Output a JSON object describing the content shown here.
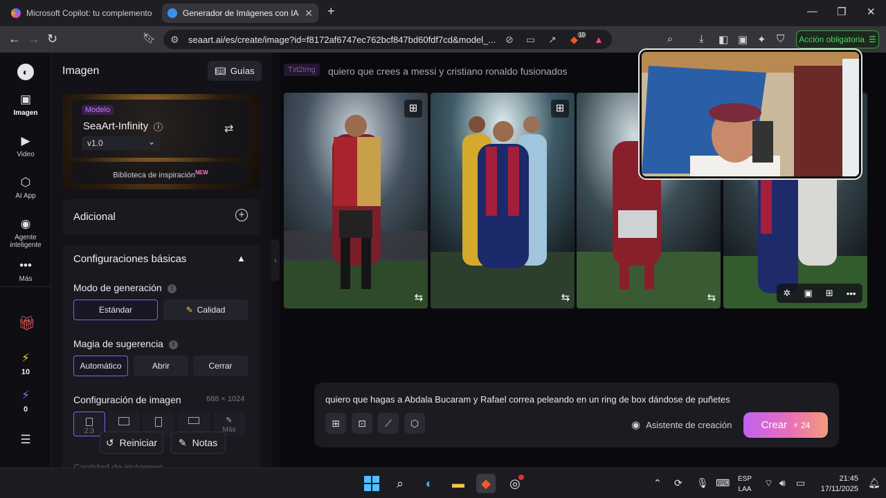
{
  "browser": {
    "tabs": [
      {
        "label": "Microsoft Copilot: tu complemento de",
        "active": false
      },
      {
        "label": "Generador de Imágenes con IA -",
        "active": true
      }
    ],
    "url": "seaart.ai/es/create/image?id=f8172af6747ec762bcf847bd60fdf7cd&model_...",
    "brave_badge": "10",
    "action_button": "Acción obligatoria"
  },
  "rail": {
    "items": [
      {
        "label": "",
        "icon": "logo-icon"
      },
      {
        "label": "Imagen",
        "icon": "image-icon"
      },
      {
        "label": "Video",
        "icon": "video-icon"
      },
      {
        "label": "AI App",
        "icon": "ai-app-icon"
      },
      {
        "label": "Agente inteligente",
        "icon": "agent-icon"
      },
      {
        "label": "Más",
        "icon": "more-icon"
      }
    ],
    "gift_icon": "gift-icon",
    "energy_count": "10",
    "stamina_count": "0"
  },
  "panel": {
    "title": "Imagen",
    "guides_label": "Guías",
    "model": {
      "tag": "Modelo",
      "name": "SeaArt-Infinity",
      "version": "v1.0",
      "library_label": "Biblioteca de inspiración",
      "library_badge": "NEW"
    },
    "additional_label": "Adicional",
    "basic_settings_label": "Configuraciones básicas",
    "generation_mode": {
      "label": "Modo de generación",
      "options": [
        "Estándar",
        "Calidad"
      ],
      "selected": "Estándar"
    },
    "prompt_magic": {
      "label": "Magia de sugerencia",
      "options": [
        "Automático",
        "Abrir",
        "Cerrar"
      ],
      "selected": "Automático"
    },
    "image_config": {
      "label": "Configuración de imagen",
      "size": "688 × 1024",
      "ratios": [
        "2:3",
        "",
        "",
        "",
        "Más"
      ]
    },
    "reset_label": "Reiniciar",
    "notes_label": "Notas",
    "quantity_label": "Cantidad de imágenes"
  },
  "main": {
    "tag": "Txt2Img",
    "previous_prompt": "quiero que crees a messi y cristiano ronaldo fusionados",
    "image_count": 4,
    "prompt_input": "quiero que hagas a Abdala Bucaram y Rafael correa peleando en un ring de box dándose de puñetes",
    "assistant_label": "Asistente de creación",
    "create_label": "Crear",
    "create_cost": "24"
  },
  "taskbar": {
    "lang_top": "ESP",
    "lang_bottom": "LAA",
    "time": "21:45",
    "date": "17/11/2025"
  },
  "colors": {
    "accent": "#8a5cf6",
    "create_gradient_start": "#c062f0",
    "create_gradient_end": "#f59a7a",
    "action_green": "#59d463"
  }
}
